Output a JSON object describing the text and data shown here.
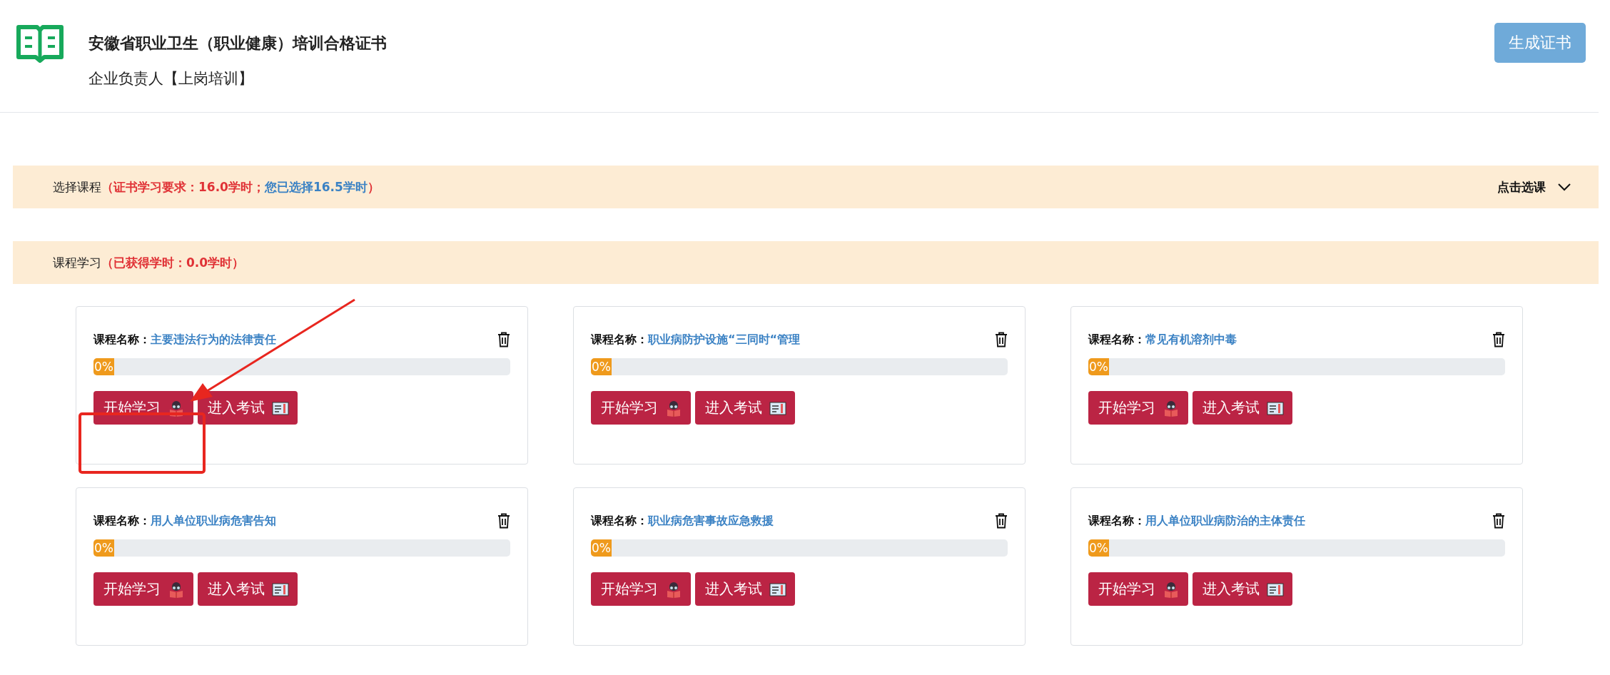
{
  "header": {
    "title": "安徽省职业卫生（职业健康）培训合格证书",
    "subtitle": "企业负责人【上岗培训】",
    "generate_button": "生成证书"
  },
  "select_banner": {
    "label": "选择课程",
    "requirement": "（证书学习要求：16.0学时；",
    "selected_hours": "您已选择16.5学时",
    "closing": "）",
    "action": "点击选课"
  },
  "study_banner": {
    "label": "课程学习",
    "earned": "（已获得学时：0.0学时）"
  },
  "courses": [
    {
      "name_label": "课程名称：",
      "name": "主要违法行为的法律责任",
      "level": 0,
      "progress_text": "0%",
      "study_button": "开始学习",
      "exam_button": "进入考试"
    },
    {
      "name_label": "课程名称：",
      "name": "职业病防护设施“三同时“管理",
      "level": 0,
      "progress_text": "0%",
      "study_button": "开始学习",
      "exam_button": "进入考试"
    },
    {
      "name_label": "课程名称：",
      "name": "常见有机溶剂中毒",
      "level": 0,
      "progress_text": "0%",
      "study_button": "开始学习",
      "exam_button": "进入考试"
    },
    {
      "name_label": "课程名称：",
      "name": "用人单位职业病危害告知",
      "level": 0,
      "progress_text": "0%",
      "study_button": "开始学习",
      "exam_button": "进入考试"
    },
    {
      "name_label": "课程名称：",
      "name": "职业病危害事故应急救援",
      "level": 0,
      "progress_text": "0%",
      "study_button": "开始学习",
      "exam_button": "进入考试"
    },
    {
      "name_label": "课程名称：",
      "name": "用人单位职业病防治的主体责任",
      "level": 0,
      "progress_text": "0%",
      "study_button": "开始学习",
      "exam_button": "进入考试"
    }
  ]
}
